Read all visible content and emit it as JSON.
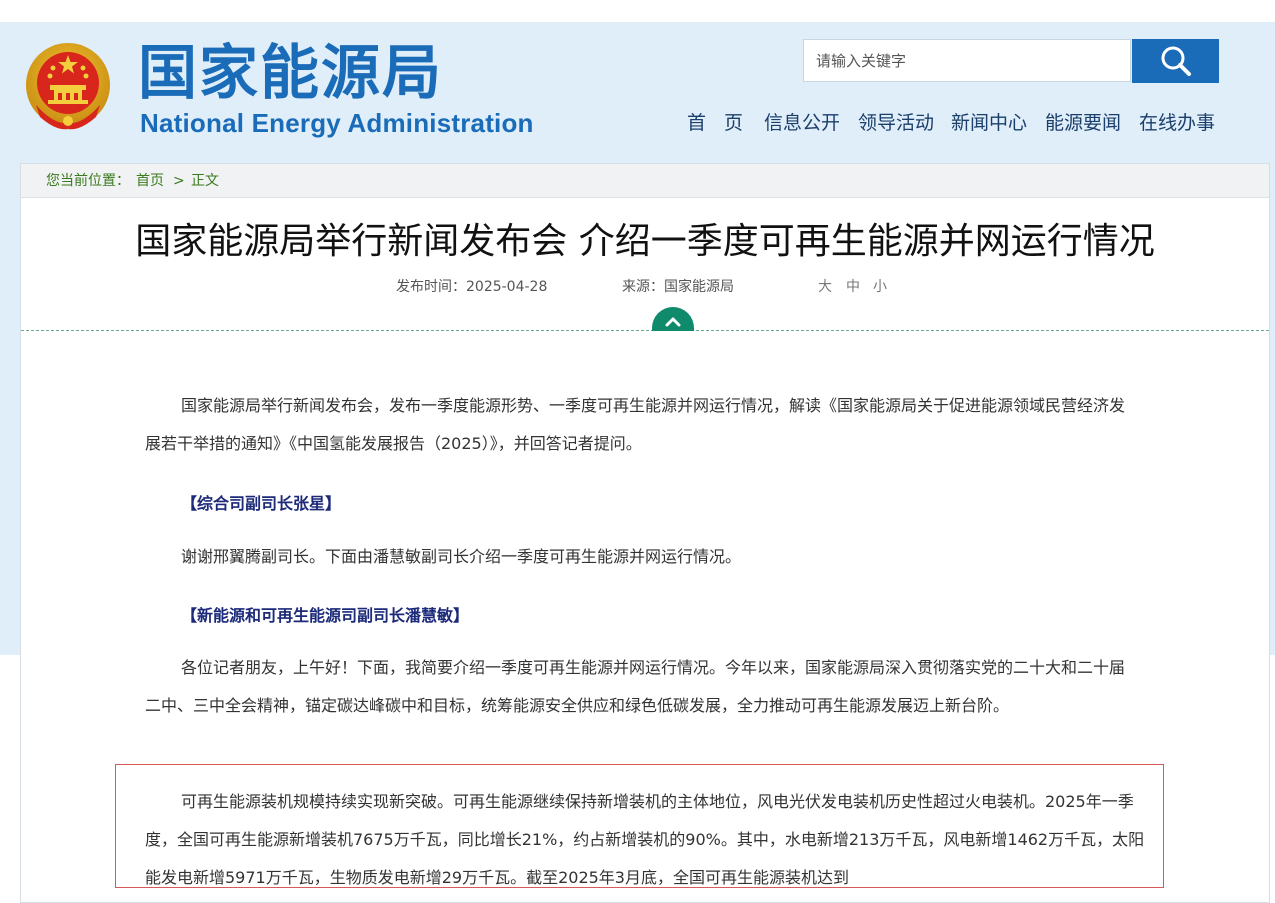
{
  "header": {
    "logo_cn": "国家能源局",
    "logo_en": "National Energy Administration",
    "search": {
      "placeholder": "请输入关键字"
    },
    "nav": [
      "首 页",
      "信息公开",
      "领导活动",
      "新闻中心",
      "能源要闻",
      "在线办事"
    ]
  },
  "breadcrumb": {
    "prefix": "您当前位置：",
    "home": "首页",
    "separator": ">",
    "current": "正文"
  },
  "article": {
    "title": "国家能源局举行新闻发布会 介绍一季度可再生能源并网运行情况",
    "date": "发布时间：2025-04-28",
    "source": "来源：国家能源局",
    "font_sizes": [
      "大",
      "中",
      "小"
    ],
    "paragraphs": [
      "国家能源局举行新闻发布会，发布一季度能源形势、一季度可再生能源并网运行情况，解读《国家能源局关于促进能源领域民营经济发展若干举措的通知》《中国氢能发展报告（2025）》，并回答记者提问。",
      "谢谢邢翼腾副司长。下面由潘慧敏副司长介绍一季度可再生能源并网运行情况。",
      "各位记者朋友，上午好！下面，我简要介绍一季度可再生能源并网运行情况。今年以来，国家能源局深入贯彻落实党的二十大和二十届二中、三中全会精神，锚定碳达峰碳中和目标，统筹能源安全供应和绿色低碳发展，全力推动可再生能源发展迈上新台阶。",
      "可再生能源装机规模持续实现新突破。可再生能源继续保持新增装机的主体地位，风电光伏发电装机历史性超过火电装机。2025年一季度，全国可再生能源新增装机7675万千瓦，同比增长21%，约占新增装机的90%。其中，水电新增213万千瓦，风电新增1462万千瓦，太阳能发电新增5971万千瓦，生物质发电新增29万千瓦。截至2025年3月底，全国可再生能源装机达到"
    ],
    "speakers": [
      "【综合司副司长张星】",
      "【新能源和可再生能源司副司长潘慧敏】"
    ]
  },
  "colors": {
    "brand_blue": "#1a6bb8",
    "header_bg": "#dfeef9",
    "speaker": "#1d2a7a",
    "breadcrumb": "#3a7a1e",
    "collapse_button": "#0f8a6b",
    "highlight_border": "#d9595a"
  },
  "icons": [
    "national-emblem-icon",
    "search-icon",
    "chevron-up-icon"
  ]
}
